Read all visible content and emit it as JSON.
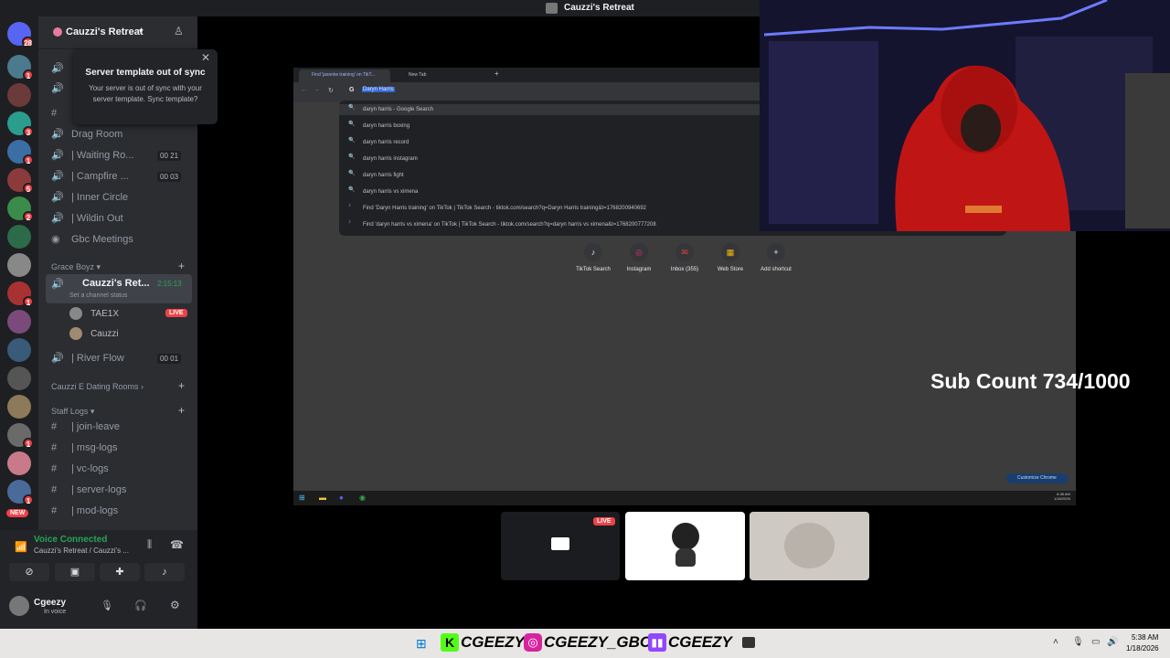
{
  "window_title": "Cauzzi's Retreat",
  "rail": {
    "badge_top": "28",
    "badges": [
      "1",
      "3",
      "1",
      "5",
      "2",
      "1",
      "1",
      "1"
    ],
    "new_badge": "NEW"
  },
  "server": {
    "name": "Cauzzi's Retreat",
    "popup": {
      "title": "Server template out of sync",
      "body": "Your server is out of sync with your server template. Sync template?",
      "close": "✕"
    },
    "channels": [
      {
        "name": "Drag Room",
        "count": ""
      },
      {
        "name": "| Waiting Ro...",
        "count": "00 21"
      },
      {
        "name": "| Campfire ...",
        "count": "00 03"
      },
      {
        "name": "| Inner Circle",
        "count": ""
      },
      {
        "name": "| Wildin Out",
        "count": ""
      },
      {
        "name": "Gbc Meetings",
        "count": ""
      }
    ],
    "category_grace": "Grace Boyz",
    "active_voice": {
      "name": "Cauzzi's Ret...",
      "timer": "2:15:13",
      "status": "Set a channel status"
    },
    "members": [
      {
        "name": "TAE1X",
        "live": "LIVE"
      },
      {
        "name": "Cauzzi",
        "live": ""
      }
    ],
    "river_flow": {
      "name": "| River Flow",
      "count": "00 01"
    },
    "category_dating": "Cauzzi E Dating Rooms",
    "category_staff": "Staff Logs",
    "staff_channels": [
      "| join-leave",
      "| msg-logs",
      "| vc-logs",
      "| server-logs",
      "| mod-logs"
    ]
  },
  "voice_panel": {
    "status": "Voice Connected",
    "location": "Cauzzi's Retreat / Cauzzi's ...",
    "user": "Cgeezy",
    "user_status": "In voice"
  },
  "browser": {
    "tabs": [
      "Find 'jasontw training' on TikT...",
      "New Tab"
    ],
    "omnibox_value": "Daryn Harris",
    "suggestions": [
      "daryn harris - Google Search",
      "daryn harris boxing",
      "daryn harris record",
      "daryn harris instagram",
      "daryn harris fight",
      "daryn harris vs ximena",
      "Find 'Daryn Harris training' on TikTok | TikTok Search - tiktok.com/search?q=Daryn Harris training&t=1768200940692",
      "Find 'daryn harris vs ximena' on TikTok | TikTok Search - tiktok.com/search?q=daryn harris vs ximena&t=1768200777208"
    ],
    "shortcuts": [
      "TikTok Search",
      "Instagram",
      "Inbox (355)",
      "Web Store",
      "Add shortcut"
    ],
    "customize": "Customize Chrome",
    "clock_time": "6:38 AM",
    "clock_date": "1/18/2026"
  },
  "overlay": {
    "sub_count": "Sub Count 734/1000",
    "live": "LIVE"
  },
  "taskbar": {
    "socials": [
      "CGEEZY",
      "CGEEZY_GBC",
      "CGEEZY"
    ],
    "time": "5:38 AM",
    "date": "1/18/2026"
  },
  "colors": {
    "discord_green": "#23a55a",
    "live_red": "#ed4245",
    "twitch_purple": "#9146ff",
    "kick_green": "#53fc18"
  }
}
